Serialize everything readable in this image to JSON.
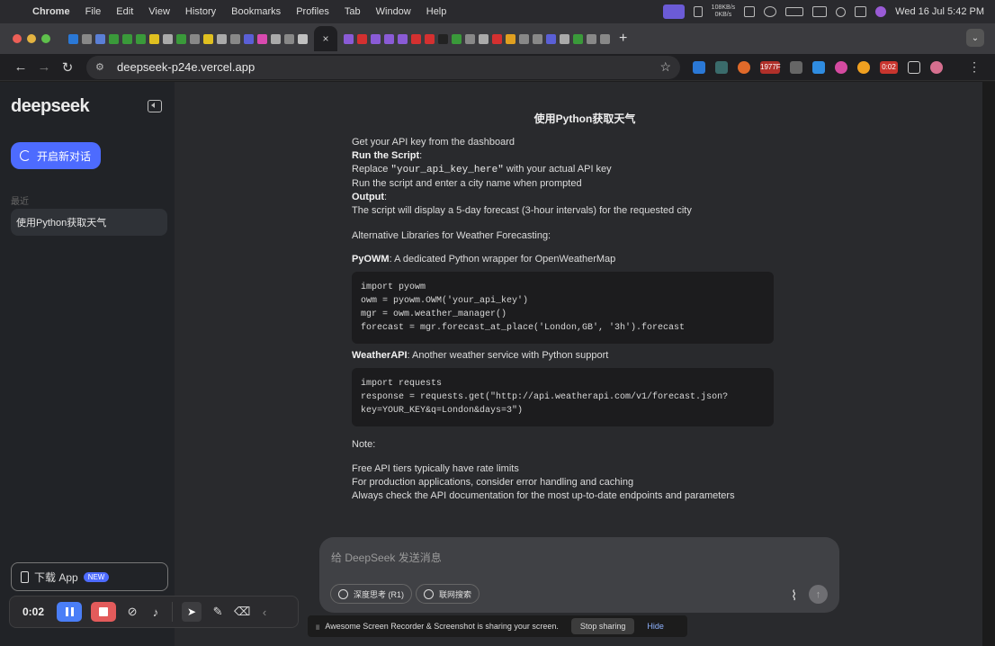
{
  "menubar": {
    "app": "Chrome",
    "items": [
      "File",
      "Edit",
      "View",
      "History",
      "Bookmarks",
      "Profiles",
      "Tab",
      "Window",
      "Help"
    ],
    "net_up": "108KB/s",
    "net_down": "0KB/s",
    "datetime": "Wed 16 Jul  5:42 PM"
  },
  "browser": {
    "url": "deepseek-p24e.vercel.app",
    "tab_close": "×",
    "rec_time_badge": "0:02",
    "ext_badge": "1977F"
  },
  "sidebar": {
    "logo": "deepseek",
    "new_chat_label": "开启新对话",
    "history_label": "最近",
    "history_items": [
      "使用Python获取天气"
    ],
    "download_label": "下载 App",
    "download_badge": "NEW"
  },
  "chat": {
    "title": "使用Python获取天气",
    "line1": "Get your API key from the dashboard",
    "run_heading": "Run the Script",
    "run_replace_pre": "Replace ",
    "run_replace_code": "\"your_api_key_here\"",
    "run_replace_post": " with your actual API key",
    "run_line2": "Run the script and enter a city name when prompted",
    "output_heading": "Output",
    "output_line": "The script will display a 5-day forecast (3-hour intervals) for the requested city",
    "alt_heading": "Alternative Libraries for Weather Forecasting:",
    "pyowm_name": "PyOWM",
    "pyowm_desc": ": A dedicated Python wrapper for OpenWeatherMap",
    "pyowm_code": "import pyowm\nowm = pyowm.OWM('your_api_key')\nmgr = owm.weather_manager()\nforecast = mgr.forecast_at_place('London,GB', '3h').forecast",
    "weatherapi_name": "WeatherAPI",
    "weatherapi_desc": ": Another weather service with Python support",
    "weatherapi_code": "import requests\nresponse = requests.get(\"http://api.weatherapi.com/v1/forecast.json?\nkey=YOUR_KEY&q=London&days=3\")",
    "note_heading": "Note:",
    "notes": [
      "Free API tiers typically have rate limits",
      "For production applications, consider error handling and caching",
      "Always check the API documentation for the most up-to-date endpoints and parameters"
    ]
  },
  "composer": {
    "placeholder": "给 DeepSeek 发送消息",
    "deep_think_label": "深度思考 (R1)",
    "web_search_label": "联网搜索"
  },
  "recorder": {
    "time": "0:02"
  },
  "share_banner": {
    "message": "Awesome Screen Recorder & Screenshot is sharing your screen.",
    "stop_label": "Stop sharing",
    "hide_label": "Hide"
  }
}
